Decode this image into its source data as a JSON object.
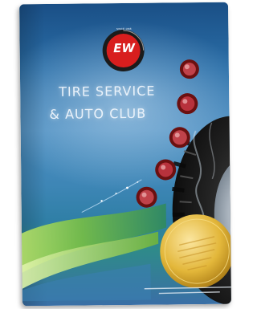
{
  "brochure": {
    "logo": {
      "top_text": "SINCE 1966",
      "letters": "EW"
    },
    "headline": {
      "line1": "TIRE SERVICE",
      "line2": "& AUTO CLUB"
    },
    "badge_text": "",
    "footer_text": ""
  },
  "colors": {
    "logo_red": "#d81e1e",
    "background_blue": "#2b6fa8",
    "swoosh_green": "#7cc23f",
    "badge_gold": "#e3b73a"
  }
}
